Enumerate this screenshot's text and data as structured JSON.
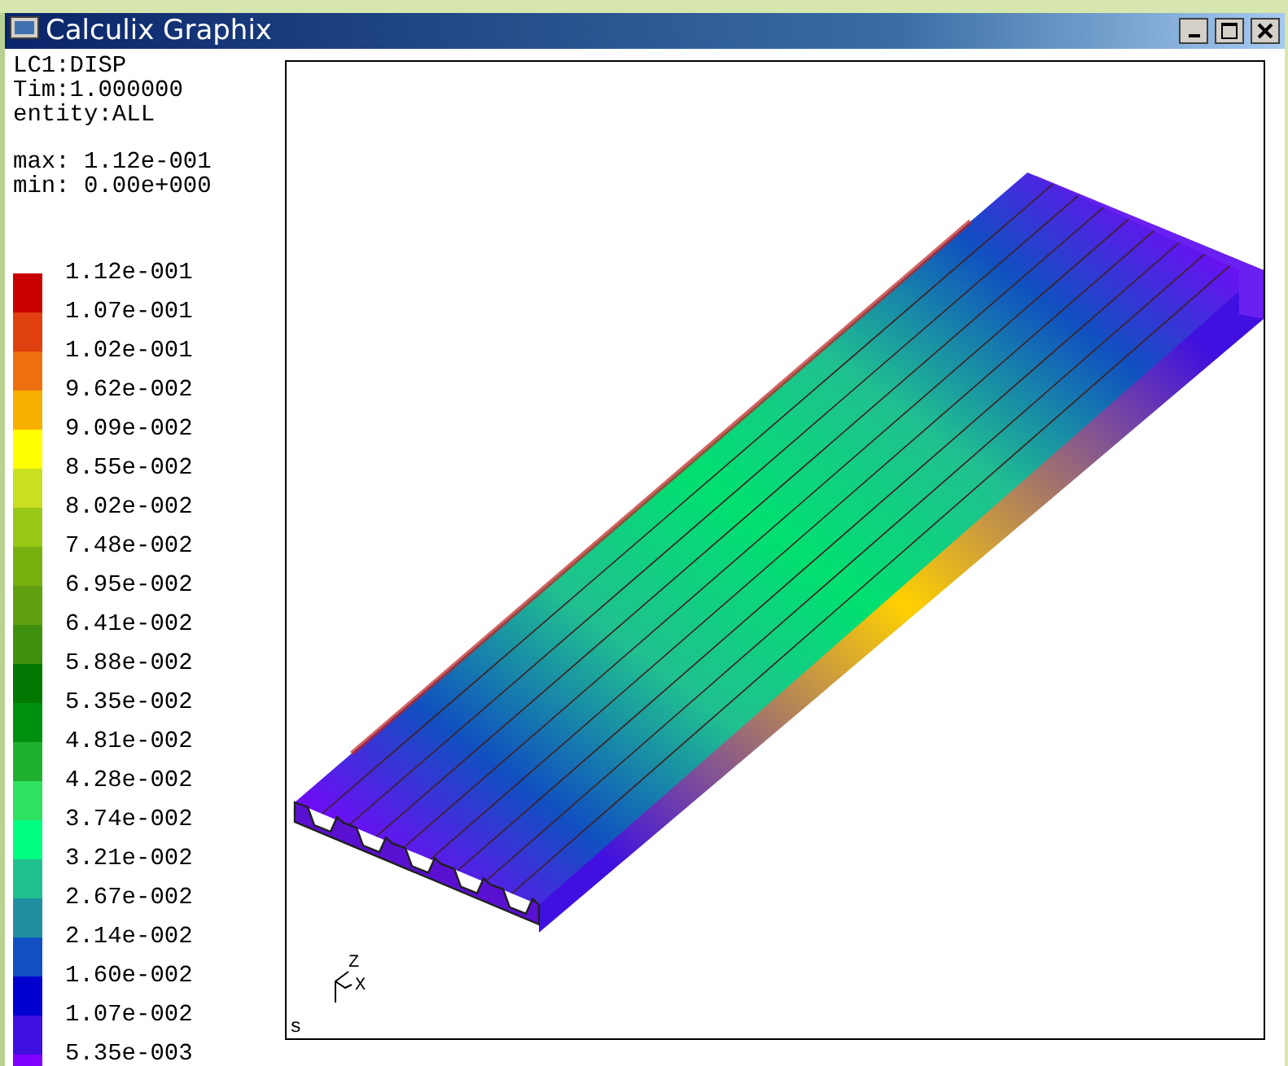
{
  "window": {
    "title": "Calculix Graphix"
  },
  "info": {
    "lines": [
      "LC1:DISP",
      "Tim:1.000000",
      "entity:ALL"
    ],
    "max": "max: 1.12e-001",
    "min": "min: 0.00e+000"
  },
  "legend": [
    {
      "label": "1.12e-001",
      "color": "#c80000"
    },
    {
      "label": "1.07e-001",
      "color": "#e04010"
    },
    {
      "label": "1.02e-001",
      "color": "#f07010"
    },
    {
      "label": "9.62e-002",
      "color": "#f8b000"
    },
    {
      "label": "9.09e-002",
      "color": "#ffff00"
    },
    {
      "label": "8.55e-002",
      "color": "#c8e020"
    },
    {
      "label": "8.02e-002",
      "color": "#98c818"
    },
    {
      "label": "7.48e-002",
      "color": "#78b010"
    },
    {
      "label": "6.95e-002",
      "color": "#60a010"
    },
    {
      "label": "6.41e-002",
      "color": "#409010"
    },
    {
      "label": "5.88e-002",
      "color": "#007800"
    },
    {
      "label": "5.35e-002",
      "color": "#009010"
    },
    {
      "label": "4.81e-002",
      "color": "#20b030"
    },
    {
      "label": "4.28e-002",
      "color": "#30e060"
    },
    {
      "label": "3.74e-002",
      "color": "#00ff80"
    },
    {
      "label": "3.21e-002",
      "color": "#20c090"
    },
    {
      "label": "2.67e-002",
      "color": "#2090a0"
    },
    {
      "label": "2.14e-002",
      "color": "#1050c0"
    },
    {
      "label": "1.60e-002",
      "color": "#0000d0"
    },
    {
      "label": "1.07e-002",
      "color": "#4010e0"
    },
    {
      "label": "5.35e-003",
      "color": "#8000ff"
    }
  ],
  "plot": {
    "axis_labels": [
      "Z",
      "X"
    ],
    "corner_label": "s"
  }
}
